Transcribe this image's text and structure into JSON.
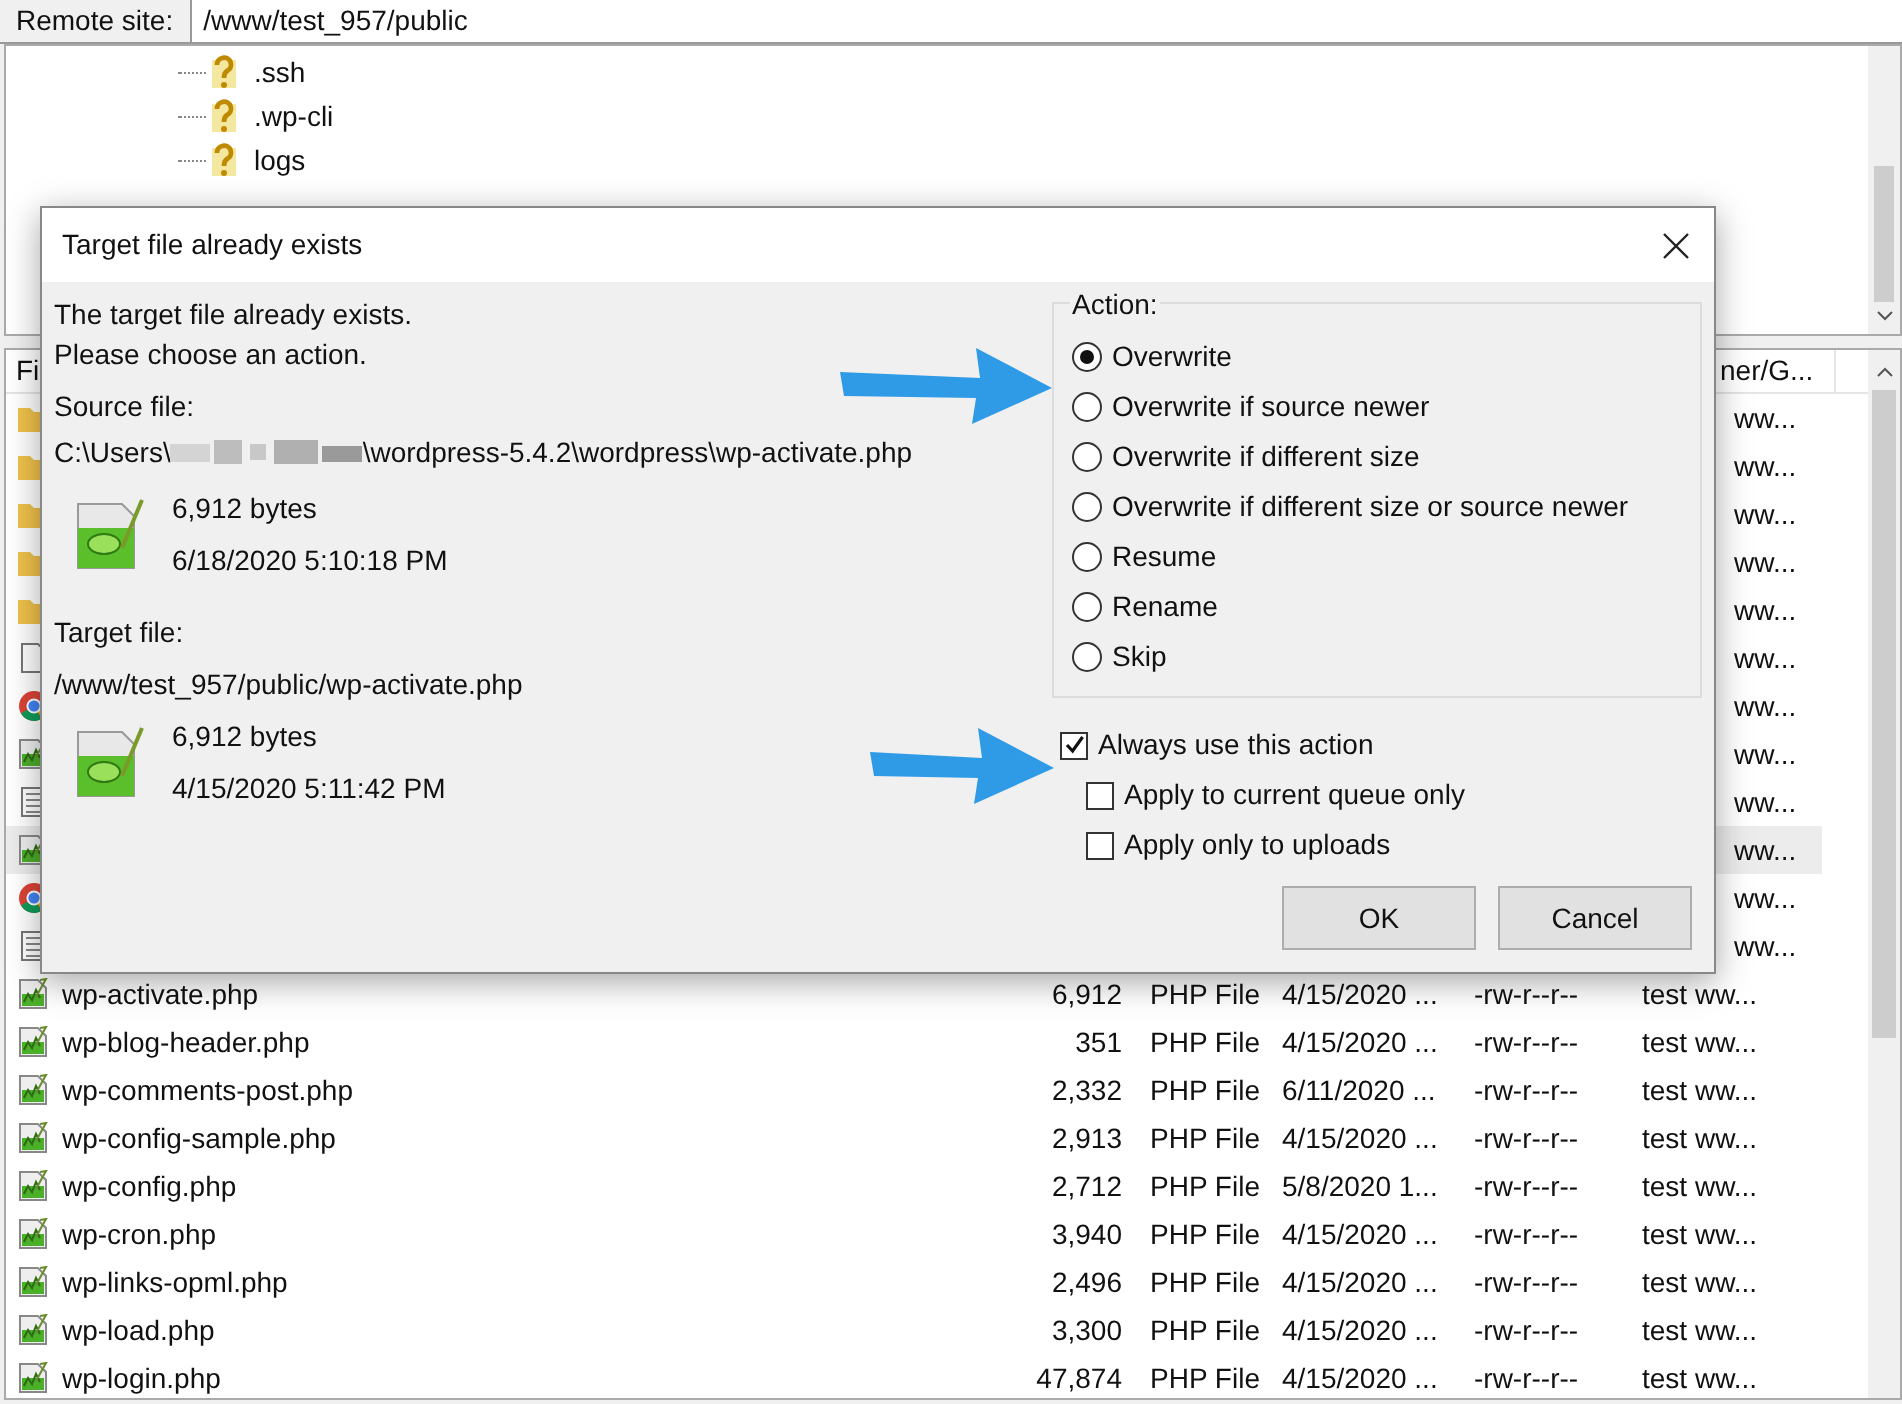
{
  "remote_site": {
    "label": "Remote site:",
    "path": "/www/test_957/public"
  },
  "tree": {
    "items": [
      {
        "name": ".ssh"
      },
      {
        "name": ".wp-cli"
      },
      {
        "name": "logs"
      }
    ]
  },
  "file_list": {
    "columns": [
      {
        "label": "Fi"
      },
      {
        "label": "ner/G..."
      }
    ],
    "rows": [
      {
        "kind": "folder",
        "owner": "ww...",
        "selected": false
      },
      {
        "kind": "folder",
        "owner": "ww...",
        "selected": false
      },
      {
        "kind": "folder",
        "owner": "ww...",
        "selected": false
      },
      {
        "kind": "folder",
        "owner": "ww...",
        "selected": false
      },
      {
        "kind": "folder",
        "owner": "ww...",
        "selected": false
      },
      {
        "kind": "blank",
        "owner": "ww...",
        "selected": false
      },
      {
        "kind": "browser",
        "owner": "ww...",
        "selected": false
      },
      {
        "kind": "php",
        "owner": "ww...",
        "selected": false
      },
      {
        "kind": "text",
        "owner": "ww...",
        "selected": false
      },
      {
        "kind": "php",
        "owner": "ww...",
        "selected": true
      },
      {
        "kind": "browser",
        "owner": "ww...",
        "selected": false
      },
      {
        "kind": "text",
        "owner": "ww...",
        "selected": false
      },
      {
        "kind": "php",
        "name": "wp-activate.php",
        "size": "6,912",
        "type": "PHP File",
        "modified": "4/15/2020 ...",
        "permissions": "-rw-r--r--",
        "owner": "test ww...",
        "selected": false
      },
      {
        "kind": "php",
        "name": "wp-blog-header.php",
        "size": "351",
        "type": "PHP File",
        "modified": "4/15/2020 ...",
        "permissions": "-rw-r--r--",
        "owner": "test ww...",
        "selected": false
      },
      {
        "kind": "php",
        "name": "wp-comments-post.php",
        "size": "2,332",
        "type": "PHP File",
        "modified": "6/11/2020 ...",
        "permissions": "-rw-r--r--",
        "owner": "test ww...",
        "selected": false
      },
      {
        "kind": "php",
        "name": "wp-config-sample.php",
        "size": "2,913",
        "type": "PHP File",
        "modified": "4/15/2020 ...",
        "permissions": "-rw-r--r--",
        "owner": "test ww...",
        "selected": false
      },
      {
        "kind": "php",
        "name": "wp-config.php",
        "size": "2,712",
        "type": "PHP File",
        "modified": "5/8/2020 1...",
        "permissions": "-rw-r--r--",
        "owner": "test ww...",
        "selected": false
      },
      {
        "kind": "php",
        "name": "wp-cron.php",
        "size": "3,940",
        "type": "PHP File",
        "modified": "4/15/2020 ...",
        "permissions": "-rw-r--r--",
        "owner": "test ww...",
        "selected": false
      },
      {
        "kind": "php",
        "name": "wp-links-opml.php",
        "size": "2,496",
        "type": "PHP File",
        "modified": "4/15/2020 ...",
        "permissions": "-rw-r--r--",
        "owner": "test ww...",
        "selected": false
      },
      {
        "kind": "php",
        "name": "wp-load.php",
        "size": "3,300",
        "type": "PHP File",
        "modified": "4/15/2020 ...",
        "permissions": "-rw-r--r--",
        "owner": "test ww...",
        "selected": false
      },
      {
        "kind": "php",
        "name": "wp-login.php",
        "size": "47,874",
        "type": "PHP File",
        "modified": "4/15/2020 ...",
        "permissions": "-rw-r--r--",
        "owner": "test ww...",
        "selected": false
      }
    ]
  },
  "dialog": {
    "title": "Target file already exists",
    "message": [
      "The target file already exists.",
      "Please choose an action."
    ],
    "source": {
      "label": "Source file:",
      "path_start": "C:\\Users\\",
      "path_end": "\\wordpress-5.4.2\\wordpress\\wp-activate.php",
      "size": "6,912 bytes",
      "date": "6/18/2020 5:10:18 PM"
    },
    "target": {
      "label": "Target file:",
      "path": "/www/test_957/public/wp-activate.php",
      "size": "6,912 bytes",
      "date": "4/15/2020 5:11:42 PM"
    },
    "action": {
      "label": "Action:",
      "options": [
        {
          "label": "Overwrite",
          "selected": true
        },
        {
          "label": "Overwrite if source newer",
          "selected": false
        },
        {
          "label": "Overwrite if different size",
          "selected": false
        },
        {
          "label": "Overwrite if different size or source newer",
          "selected": false
        },
        {
          "label": "Resume",
          "selected": false
        },
        {
          "label": "Rename",
          "selected": false
        },
        {
          "label": "Skip",
          "selected": false
        }
      ]
    },
    "always": {
      "label": "Always use this action",
      "checked": true
    },
    "sub_options": [
      {
        "label": "Apply to current queue only",
        "checked": false
      },
      {
        "label": "Apply only to uploads",
        "checked": false
      }
    ],
    "buttons": [
      {
        "label": "OK"
      },
      {
        "label": "Cancel"
      }
    ]
  }
}
